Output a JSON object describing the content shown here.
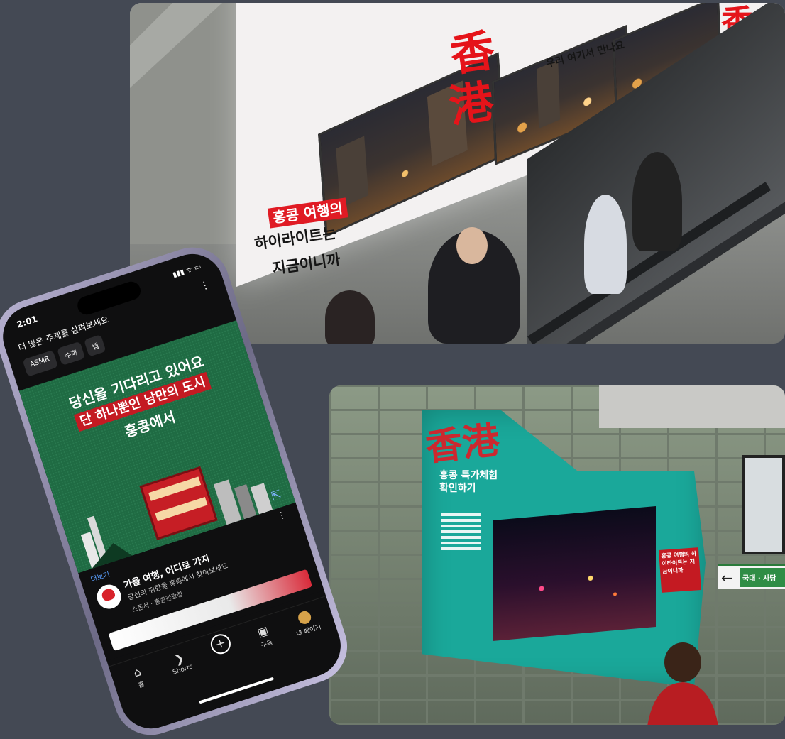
{
  "top_photo": {
    "board_hanzi_1": "香",
    "board_hanzi_2": "港",
    "board_hanzi_right": "香港",
    "board_tag": "홍콩 여행의",
    "board_line2": "하이라이트는",
    "board_line3": "지금이니까",
    "board_caption": "우리 여기서 만나요"
  },
  "phone": {
    "time": "2:01",
    "status_icons": "▮▮▮ ᯤ ▭",
    "section_title": "더 많은 주제를 살펴보세요",
    "chips": [
      "ASMR",
      "수학",
      "랩"
    ],
    "ad": {
      "line1": "당신을 기다리고 있어요",
      "line2": "단 하나뿐인 낭만의 도시",
      "line3": "홍콩에서"
    },
    "card": {
      "more_link": "더보기",
      "title": "가을 여행, 어디로 가지",
      "subtitle": "당신의 취향을 홍콩에서 찾아보세요",
      "meta": "스폰서 · 홍콩관광청"
    },
    "tabs": [
      {
        "label": "홈",
        "icon": "⌂"
      },
      {
        "label": "Shorts",
        "icon": "❯"
      },
      {
        "label": "",
        "icon": "+"
      },
      {
        "label": "구독",
        "icon": "▣"
      },
      {
        "label": "내 페이지",
        "icon": ""
      }
    ]
  },
  "bottom_photo": {
    "panel_hanzi": "香港",
    "panel_text": "홍콩 특가체험\n확인하기",
    "side_text": "홍콩 여행의 하이라이트는 지금이니까",
    "sign_arrow": "←",
    "sign_text": "국대 · 사당"
  }
}
